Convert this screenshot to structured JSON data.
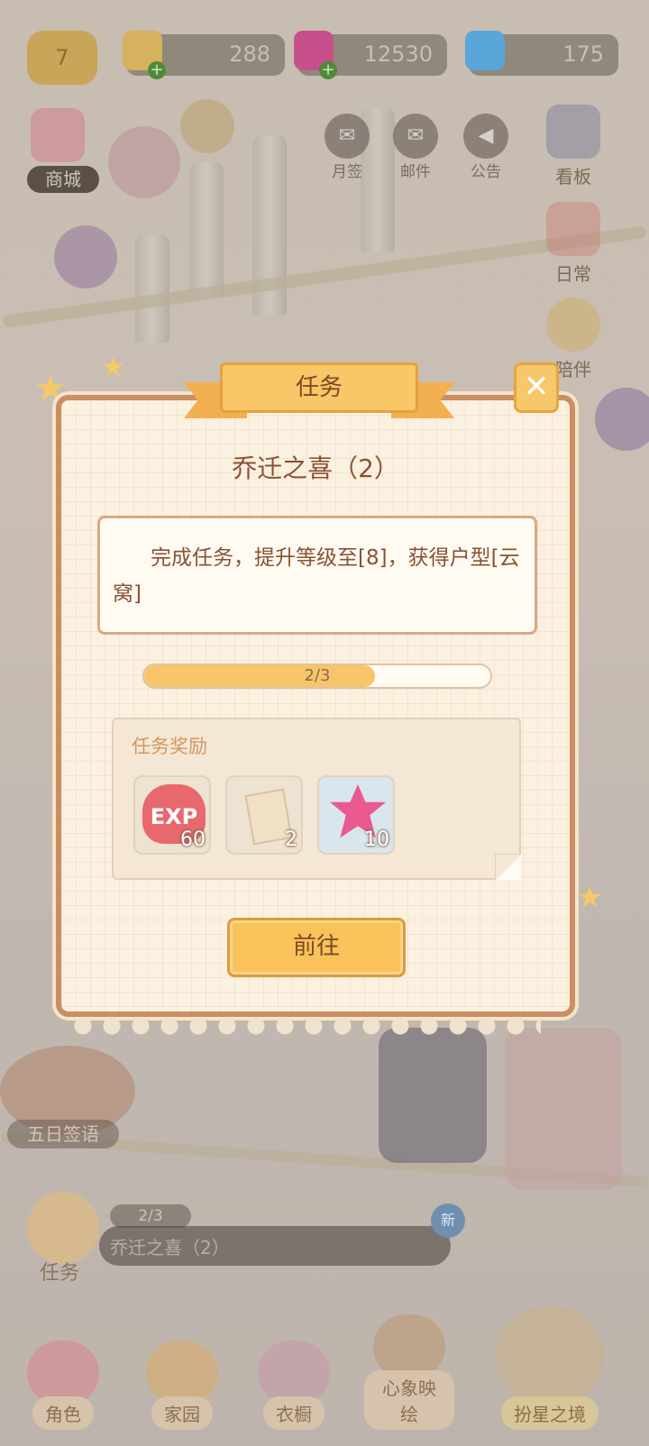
{
  "topbar": {
    "level": "7",
    "resources": [
      {
        "name": "bell-icon",
        "value": "288",
        "color": "#d6b25e"
      },
      {
        "name": "flower-gem-icon",
        "value": "12530",
        "color": "#c6508c"
      },
      {
        "name": "snowflake-icon",
        "value": "175",
        "color": "#5aa6d8"
      }
    ]
  },
  "side_buttons": {
    "shop": "商城",
    "monthly_signin": "月签",
    "mail": "邮件",
    "notice": "公告",
    "board": "看板",
    "daily": "日常",
    "partner": "陪伴"
  },
  "bottom": {
    "signin_event": "五日签语",
    "task_progress": "2/3",
    "task_name": "乔迁之喜（2）",
    "task_label": "任务",
    "new_badge": "新",
    "nav": [
      "角色",
      "家园",
      "衣橱",
      "心象映绘",
      "扮星之境"
    ]
  },
  "modal": {
    "header": "任务",
    "close": "✕",
    "title": "乔迁之喜（2）",
    "description": "完成任务，提升等级至[8]，获得户型[云窝]",
    "progress_text": "2/3",
    "progress_value": 0.6667,
    "reward_title": "任务奖励",
    "rewards": [
      {
        "icon": "exp-icon",
        "icon_text": "EXP",
        "quantity": "60"
      },
      {
        "icon": "decor-card-icon",
        "quantity": "2"
      },
      {
        "icon": "pink-star-gem-icon",
        "quantity": "10"
      }
    ],
    "go_button": "前往"
  },
  "colors": {
    "accent": "#f9c25b",
    "frame": "#c98f63",
    "text": "#8a5233"
  }
}
